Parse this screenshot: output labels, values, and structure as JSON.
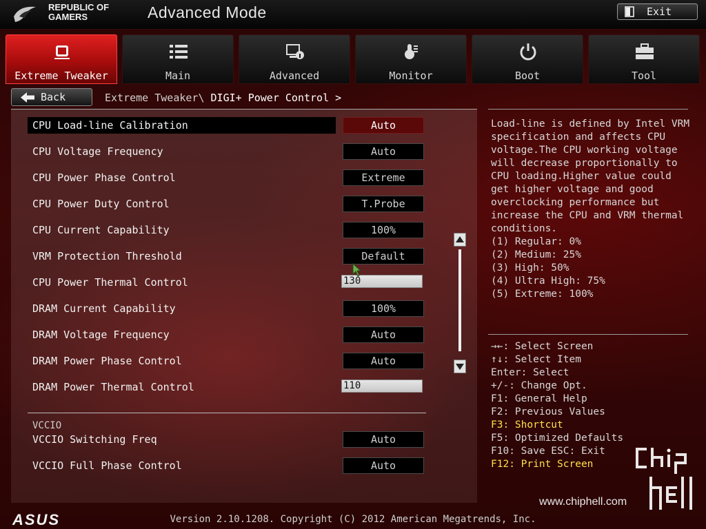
{
  "header": {
    "brand_line1": "REPUBLIC OF",
    "brand_line2": "GAMERS",
    "mode_title": "Advanced Mode",
    "exit_label": "Exit"
  },
  "tabs": [
    {
      "label": "Extreme Tweaker",
      "icon": "extreme-tweaker-icon",
      "active": true
    },
    {
      "label": "Main",
      "icon": "list-icon",
      "active": false
    },
    {
      "label": "Advanced",
      "icon": "advanced-icon",
      "active": false
    },
    {
      "label": "Monitor",
      "icon": "thermometer-icon",
      "active": false
    },
    {
      "label": "Boot",
      "icon": "power-icon",
      "active": false
    },
    {
      "label": "Tool",
      "icon": "toolbox-icon",
      "active": false
    }
  ],
  "nav": {
    "back_label": "Back",
    "breadcrumb_parent": "Extreme Tweaker\\",
    "breadcrumb_current": "DIGI+ Power Control >"
  },
  "settings": [
    {
      "name": "CPU Load-line Calibration",
      "value": "Auto",
      "kind": "select",
      "selected": true
    },
    {
      "name": "CPU Voltage Frequency",
      "value": "Auto",
      "kind": "select"
    },
    {
      "name": "CPU Power Phase Control",
      "value": "Extreme",
      "kind": "select"
    },
    {
      "name": "CPU Power Duty Control",
      "value": "T.Probe",
      "kind": "select"
    },
    {
      "name": "CPU Current Capability",
      "value": "100%",
      "kind": "select"
    },
    {
      "name": "VRM Protection Threshold",
      "value": "Default",
      "kind": "select"
    },
    {
      "name": "CPU Power Thermal Control",
      "value": "130",
      "kind": "input"
    },
    {
      "name": "DRAM Current Capability",
      "value": "100%",
      "kind": "select"
    },
    {
      "name": "DRAM Voltage Frequency",
      "value": "Auto",
      "kind": "select"
    },
    {
      "name": "DRAM Power Phase Control",
      "value": "Auto",
      "kind": "select"
    },
    {
      "name": "DRAM Power Thermal Control",
      "value": "110",
      "kind": "input"
    }
  ],
  "vccio": {
    "section_label": "VCCIO",
    "settings": [
      {
        "name": "VCCIO Switching Freq",
        "value": "Auto"
      },
      {
        "name": "VCCIO Full Phase Control",
        "value": "Auto"
      }
    ]
  },
  "help": {
    "description": "Load-line is defined by Intel VRM specification and affects CPU voltage.The CPU working voltage will decrease proportionally to CPU loading.Higher value could get higher voltage and good overclocking performance but increase the CPU and VRM thermal conditions.",
    "levels": [
      "(1) Regular: 0%",
      "(2) Medium: 25%",
      "(3) High: 50%",
      "(4) Ultra High: 75%",
      "(5) Extreme: 100%"
    ]
  },
  "keys": [
    {
      "text": "→←: Select Screen",
      "highlight": false
    },
    {
      "text": "↑↓: Select Item",
      "highlight": false
    },
    {
      "text": "Enter: Select",
      "highlight": false
    },
    {
      "text": "+/-: Change Opt.",
      "highlight": false
    },
    {
      "text": "F1: General Help",
      "highlight": false
    },
    {
      "text": "F2: Previous Values",
      "highlight": false
    },
    {
      "text": "F3: Shortcut",
      "highlight": true
    },
    {
      "text": "F5: Optimized Defaults",
      "highlight": false
    },
    {
      "text": "F10: Save  ESC: Exit",
      "highlight": false
    },
    {
      "text": "F12: Print Screen",
      "highlight": true
    }
  ],
  "watermark": {
    "url": "www.chiphell.com",
    "logo_text": "chip hell"
  },
  "footer": {
    "logo_text": "ASUS",
    "version": "Version 2.10.1208. Copyright (C) 2012 American Megatrends, Inc."
  },
  "colors": {
    "accent_red": "#c81414",
    "highlight_yellow": "#ffe04a",
    "selected_value_bg": "#5a0808"
  }
}
